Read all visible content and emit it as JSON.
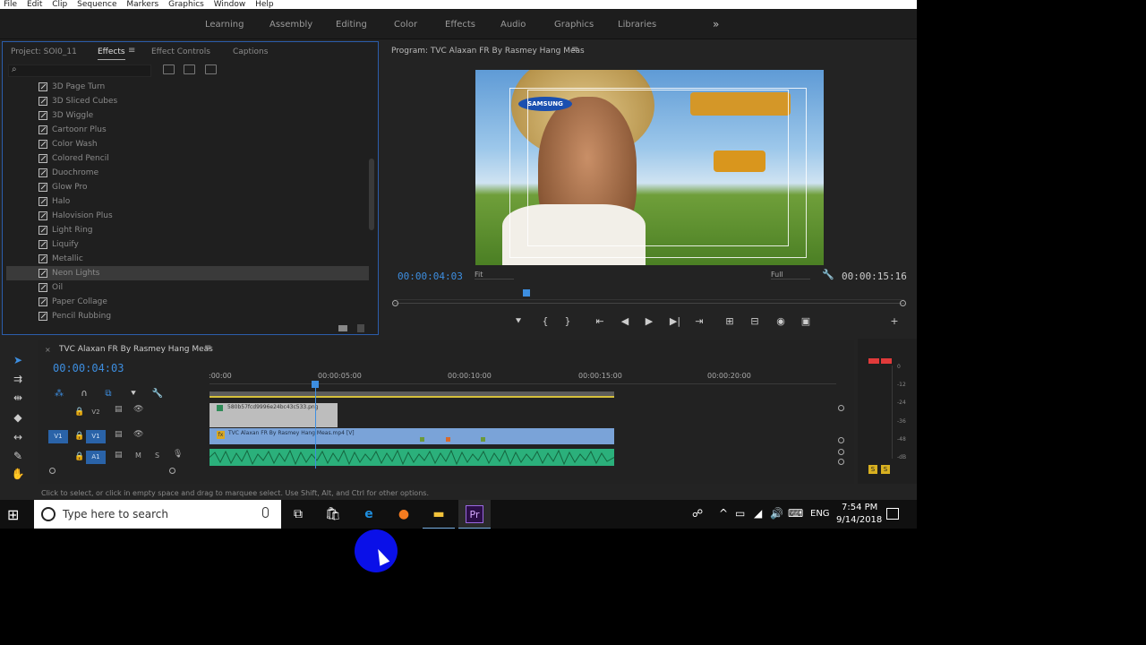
{
  "menubar": [
    "File",
    "Edit",
    "Clip",
    "Sequence",
    "Markers",
    "Graphics",
    "Window",
    "Help"
  ],
  "workspaces": [
    "Learning",
    "Assembly",
    "Editing",
    "Color",
    "Effects",
    "Audio",
    "Graphics",
    "Libraries"
  ],
  "workspaces_more": "»",
  "effects_panel": {
    "tabs": [
      "Project: SOI0_11",
      "Effects",
      "Effect Controls",
      "Captions"
    ],
    "active_tab": "Effects",
    "menu_glyph": "≡",
    "search_icon": "⌕",
    "items": [
      "3D Page Turn",
      "3D Sliced Cubes",
      "3D Wiggle",
      "Cartoonr Plus",
      "Color Wash",
      "Colored Pencil",
      "Duochrome",
      "Glow Pro",
      "Halo",
      "Halovision Plus",
      "Light Ring",
      "Liquify",
      "Metallic",
      "Neon Lights",
      "Oil",
      "Paper Collage",
      "Pencil Rubbing"
    ],
    "selected_item": "Neon Lights"
  },
  "program": {
    "title": "Program: TVC  Alaxan FR By Rasmey Hang Meas",
    "menu_glyph": "≡",
    "logo_text": "SAMSUNG",
    "current_tc": "00:00:04:03",
    "fit": "Fit",
    "quality": "Full",
    "duration_tc": "00:00:15:16",
    "controls": [
      "⯆",
      "{",
      "}",
      "⇤",
      "◀",
      "▶",
      "▶|",
      "⇥",
      "⊞",
      "⊟",
      "◉",
      "▣",
      "+"
    ]
  },
  "timeline": {
    "close_glyph": "×",
    "title": "TVC  Alaxan FR By Rasmey Hang Meas",
    "menu_glyph": "≡",
    "current_tc": "00:00:04:03",
    "ruler": [
      ":00:00",
      "00:00:05:00",
      "00:00:10:00",
      "00:00:15:00",
      "00:00:20:00"
    ],
    "tracks": {
      "v2": {
        "label": "V2"
      },
      "v1": {
        "source": "V1",
        "label": "V1"
      },
      "a1": {
        "label": "A1",
        "mute": "M",
        "solo": "S"
      }
    },
    "clips": {
      "png": "580b57fcd9996e24bc43c533.png",
      "video": "TVC  Alaxan FR By Rasmey Hang Meas.mp4 [V]",
      "video_fx": "fx"
    }
  },
  "meter": {
    "labels": [
      "0",
      "-12",
      "-24",
      "-36",
      "-48",
      "-dB"
    ],
    "solo_labels": [
      "S",
      "S"
    ]
  },
  "status_text": "Click to select, or click in empty space and drag to marquee select. Use Shift, Alt, and Ctrl for other options.",
  "taskbar": {
    "search_placeholder": "Type here to search",
    "lang": "ENG",
    "time": "7:54 PM",
    "date": "9/14/2018"
  }
}
